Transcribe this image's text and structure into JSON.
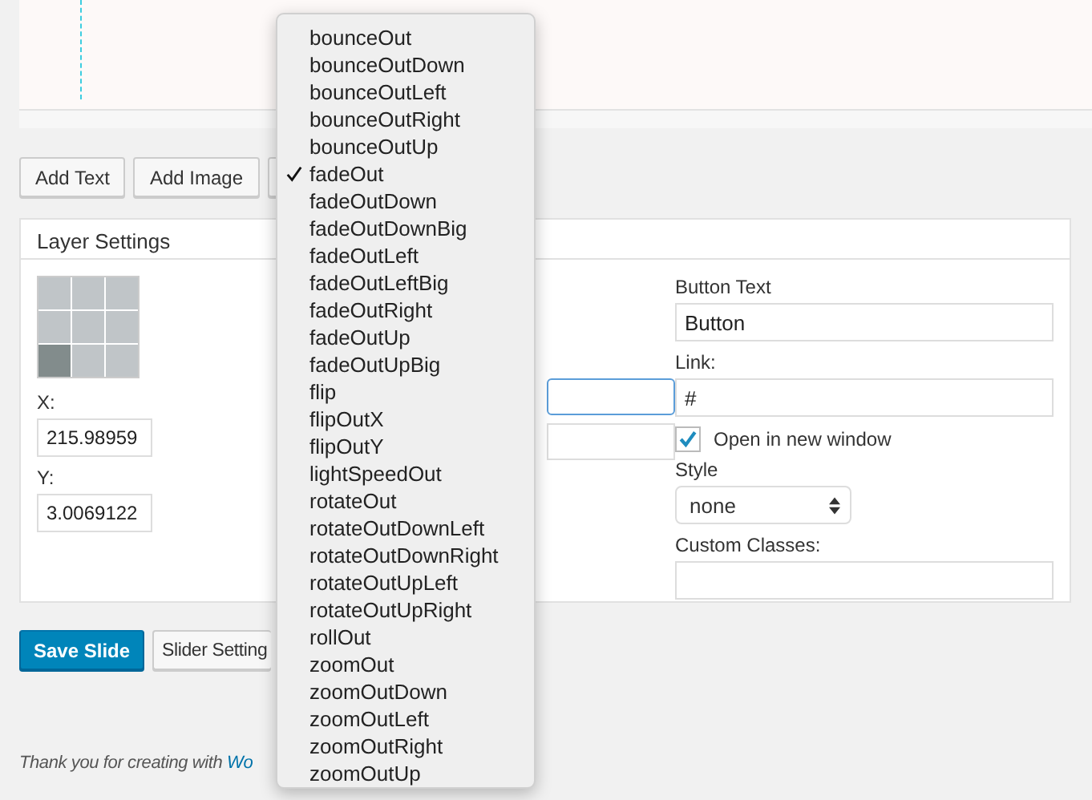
{
  "toolbar": {
    "buttons": [
      "Add Text",
      "Add Image"
    ]
  },
  "layer_settings": {
    "title": "Layer Settings",
    "position_grid": [
      {
        "selected": false
      },
      {
        "selected": false
      },
      {
        "selected": false
      },
      {
        "selected": false
      },
      {
        "selected": false
      },
      {
        "selected": false
      },
      {
        "selected": true
      },
      {
        "selected": false
      },
      {
        "selected": false
      }
    ],
    "x_label": "X:",
    "x_value": "215.98959",
    "y_label": "Y:",
    "y_value": "3.0069122",
    "button_text_label": "Button Text",
    "button_text_value": "Button",
    "link_label": "Link:",
    "link_value": "#",
    "open_new_window": {
      "label": "Open in new window",
      "checked": true
    },
    "style_label": "Style",
    "style_value": "none",
    "custom_classes_label": "Custom Classes:"
  },
  "actions": {
    "save": "Save Slide",
    "settings": "Slider Setting"
  },
  "footer": {
    "text": "Thank you for creating with ",
    "link": "Wo"
  },
  "dropdown": {
    "items": [
      {
        "label": "bounceOut",
        "selected": false
      },
      {
        "label": "bounceOutDown",
        "selected": false
      },
      {
        "label": "bounceOutLeft",
        "selected": false
      },
      {
        "label": "bounceOutRight",
        "selected": false
      },
      {
        "label": "bounceOutUp",
        "selected": false
      },
      {
        "label": "fadeOut",
        "selected": true
      },
      {
        "label": "fadeOutDown",
        "selected": false
      },
      {
        "label": "fadeOutDownBig",
        "selected": false
      },
      {
        "label": "fadeOutLeft",
        "selected": false
      },
      {
        "label": "fadeOutLeftBig",
        "selected": false
      },
      {
        "label": "fadeOutRight",
        "selected": false
      },
      {
        "label": "fadeOutUp",
        "selected": false
      },
      {
        "label": "fadeOutUpBig",
        "selected": false
      },
      {
        "label": "flip",
        "selected": false
      },
      {
        "label": "flipOutX",
        "selected": false
      },
      {
        "label": "flipOutY",
        "selected": false
      },
      {
        "label": "lightSpeedOut",
        "selected": false
      },
      {
        "label": "rotateOut",
        "selected": false
      },
      {
        "label": "rotateOutDownLeft",
        "selected": false
      },
      {
        "label": "rotateOutDownRight",
        "selected": false
      },
      {
        "label": "rotateOutUpLeft",
        "selected": false
      },
      {
        "label": "rotateOutUpRight",
        "selected": false
      },
      {
        "label": "rollOut",
        "selected": false
      },
      {
        "label": "zoomOut",
        "selected": false
      },
      {
        "label": "zoomOutDown",
        "selected": false
      },
      {
        "label": "zoomOutLeft",
        "selected": false
      },
      {
        "label": "zoomOutRight",
        "selected": false
      },
      {
        "label": "zoomOutUp",
        "selected": false
      }
    ]
  }
}
